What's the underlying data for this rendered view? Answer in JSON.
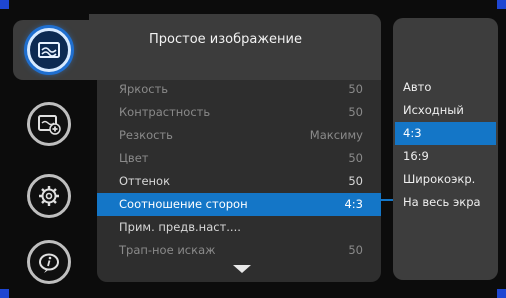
{
  "menu": {
    "title": "Простое изображение",
    "items": [
      {
        "label": "Яркость",
        "value": "50"
      },
      {
        "label": "Контрастность",
        "value": "50"
      },
      {
        "label": "Резкость",
        "value": "Максиму"
      },
      {
        "label": "Цвет",
        "value": "50"
      },
      {
        "label": "Оттенок",
        "value": "50"
      },
      {
        "label": "Соотношение сторон",
        "value": "4:3"
      },
      {
        "label": "Прим. предв.наст....",
        "value": ""
      },
      {
        "label": "Трап-ное искаж",
        "value": "50"
      }
    ]
  },
  "submenu": {
    "items": [
      "Авто",
      "Исходный",
      "4:3",
      "16:9",
      "Широкоэкр.",
      "На весь экра"
    ],
    "selected": "4:3"
  },
  "rail": {
    "icons": [
      "picture-icon",
      "add-picture-icon",
      "gear-icon",
      "info-icon"
    ],
    "active": "picture-icon"
  },
  "colors": {
    "accent": "#1476c7",
    "corner": "#1e46d2"
  }
}
